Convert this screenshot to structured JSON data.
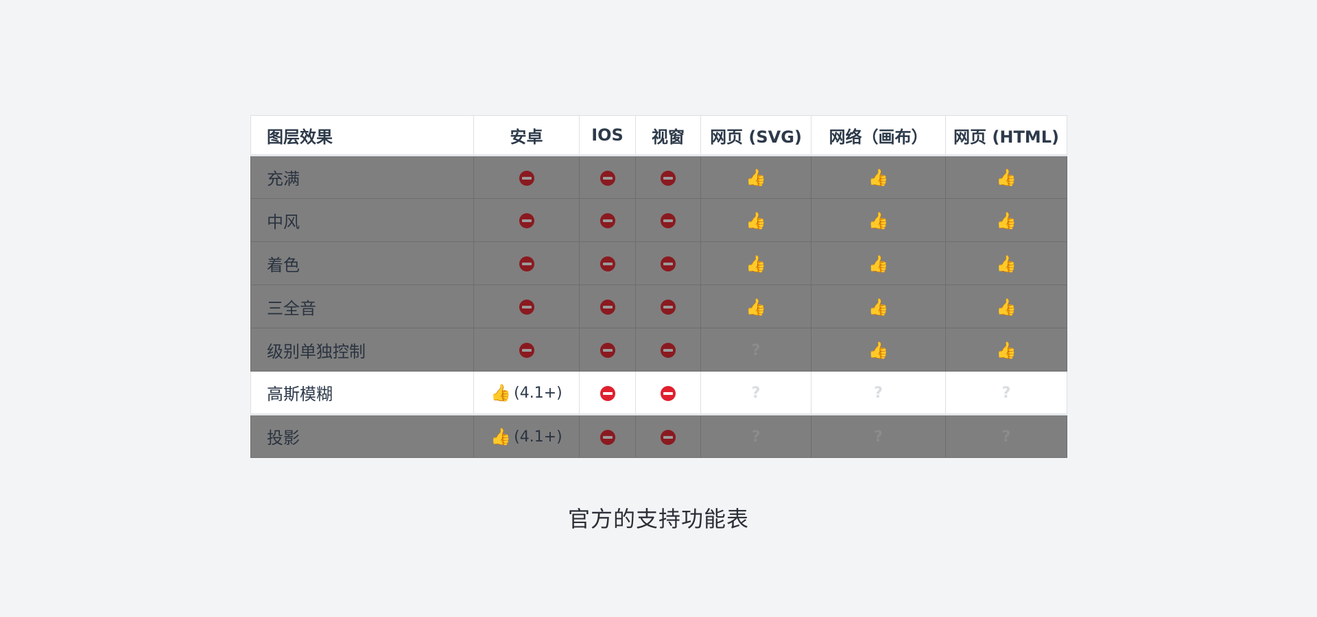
{
  "table": {
    "headers": [
      "图层效果",
      "安卓",
      "IOS",
      "视窗",
      "网页 (SVG)",
      "网络（画布）",
      "网页 (HTML)"
    ],
    "rows": [
      {
        "label": "充满",
        "dimmed": true,
        "cells": [
          {
            "icon": "no-entry-icon"
          },
          {
            "icon": "no-entry-icon"
          },
          {
            "icon": "no-entry-icon"
          },
          {
            "icon": "thumbs-up-icon"
          },
          {
            "icon": "thumbs-up-icon"
          },
          {
            "icon": "thumbs-up-icon"
          }
        ]
      },
      {
        "label": "中风",
        "dimmed": true,
        "cells": [
          {
            "icon": "no-entry-icon"
          },
          {
            "icon": "no-entry-icon"
          },
          {
            "icon": "no-entry-icon"
          },
          {
            "icon": "thumbs-up-icon"
          },
          {
            "icon": "thumbs-up-icon"
          },
          {
            "icon": "thumbs-up-icon"
          }
        ]
      },
      {
        "label": "着色",
        "dimmed": true,
        "cells": [
          {
            "icon": "no-entry-icon"
          },
          {
            "icon": "no-entry-icon"
          },
          {
            "icon": "no-entry-icon"
          },
          {
            "icon": "thumbs-up-icon"
          },
          {
            "icon": "thumbs-up-icon"
          },
          {
            "icon": "thumbs-up-icon"
          }
        ]
      },
      {
        "label": "三全音",
        "dimmed": true,
        "cells": [
          {
            "icon": "no-entry-icon"
          },
          {
            "icon": "no-entry-icon"
          },
          {
            "icon": "no-entry-icon"
          },
          {
            "icon": "thumbs-up-icon"
          },
          {
            "icon": "thumbs-up-icon"
          },
          {
            "icon": "thumbs-up-icon"
          }
        ]
      },
      {
        "label": "级别单独控制",
        "dimmed": true,
        "cells": [
          {
            "icon": "no-entry-icon"
          },
          {
            "icon": "no-entry-icon"
          },
          {
            "icon": "no-entry-icon"
          },
          {
            "icon": "question-icon"
          },
          {
            "icon": "thumbs-up-icon"
          },
          {
            "icon": "thumbs-up-icon"
          }
        ]
      },
      {
        "label": "高斯模糊",
        "dimmed": false,
        "cells": [
          {
            "icon": "thumbs-up-icon",
            "note": "(4.1+)"
          },
          {
            "icon": "no-entry-icon"
          },
          {
            "icon": "no-entry-icon"
          },
          {
            "icon": "question-icon"
          },
          {
            "icon": "question-icon"
          },
          {
            "icon": "question-icon"
          }
        ]
      },
      {
        "label": "投影",
        "dimmed": true,
        "cells": [
          {
            "icon": "thumbs-up-icon",
            "note": "(4.1+)"
          },
          {
            "icon": "no-entry-icon"
          },
          {
            "icon": "no-entry-icon"
          },
          {
            "icon": "question-icon"
          },
          {
            "icon": "question-icon"
          },
          {
            "icon": "question-icon"
          }
        ]
      }
    ]
  },
  "caption": "官方的支持功能表",
  "colors": {
    "background": "#f3f4f6",
    "dim_overlay": "#7f7f7f",
    "no_entry": "#e0202e",
    "thumbs_up": "#f2b418"
  }
}
